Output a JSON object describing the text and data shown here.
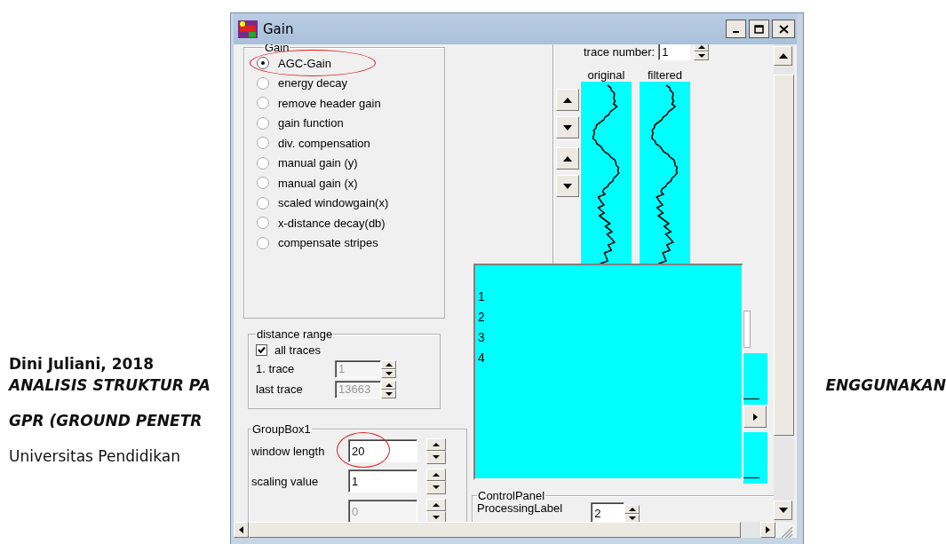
{
  "document": {
    "lines": [
      {
        "kind": "author",
        "parts": [
          "Dini Juliani, 2018"
        ]
      },
      {
        "kind": "title",
        "parts": [
          "ANALISIS STRUKTUR PA",
          "ENGGUNAKAN"
        ]
      },
      {
        "kind": "title",
        "parts": [
          "GPR (GROUND PENETR"
        ]
      },
      {
        "kind": "plain",
        "parts": [
          "Universitas Pendidikan"
        ]
      }
    ]
  },
  "window": {
    "title": "Gain"
  },
  "gain_group": {
    "legend": "Gain",
    "options": [
      {
        "label": "AGC-Gain",
        "selected": true,
        "highlighted": true
      },
      {
        "label": "energy decay",
        "selected": false,
        "highlighted": false
      },
      {
        "label": "remove header gain",
        "selected": false,
        "highlighted": false
      },
      {
        "label": "gain function",
        "selected": false,
        "highlighted": false
      },
      {
        "label": "div. compensation",
        "selected": false,
        "highlighted": false
      },
      {
        "label": "manual gain (y)",
        "selected": false,
        "highlighted": false
      },
      {
        "label": "manual gain (x)",
        "selected": false,
        "highlighted": false
      },
      {
        "label": "scaled windowgain(x)",
        "selected": false,
        "highlighted": false
      },
      {
        "label": "x-distance decay(db)",
        "selected": false,
        "highlighted": false
      },
      {
        "label": "compensate stripes",
        "selected": false,
        "highlighted": false
      }
    ]
  },
  "distance_range": {
    "legend": "distance range",
    "all_traces": {
      "label": "all traces",
      "checked": true
    },
    "fields": [
      {
        "label": "1. trace",
        "value": "1",
        "disabled": true
      },
      {
        "label": "last trace",
        "value": "13663",
        "disabled": true
      }
    ]
  },
  "group_box": {
    "legend": "GroupBox1",
    "fields": [
      {
        "label": "window length",
        "value": "20",
        "disabled": false,
        "highlighted": true
      },
      {
        "label": "scaling value",
        "value": "1",
        "disabled": false,
        "highlighted": false
      },
      {
        "value": "0",
        "disabled": true,
        "highlighted": false
      }
    ]
  },
  "trace_viewer": {
    "label": "trace number:",
    "value": "1",
    "columns": [
      "original",
      "filtered"
    ]
  },
  "list_panel": {
    "items": [
      "1",
      "2",
      "3",
      "4"
    ]
  },
  "control_panel": {
    "legend": "ControlPanel",
    "label": "ProcessingLabel",
    "value": "2"
  }
}
